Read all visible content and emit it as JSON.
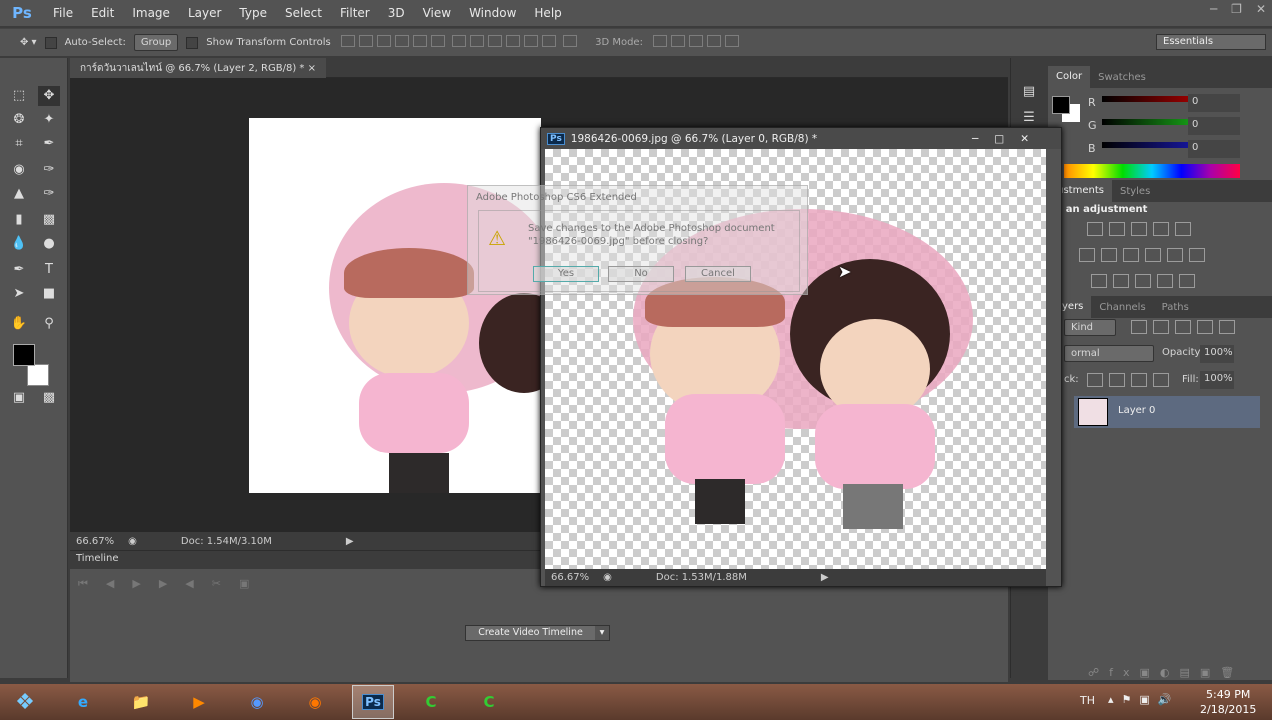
{
  "app": {
    "logo": "Ps",
    "menu": [
      "File",
      "Edit",
      "Image",
      "Layer",
      "Type",
      "Select",
      "Filter",
      "3D",
      "View",
      "Window",
      "Help"
    ]
  },
  "options": {
    "auto_select": "Auto-Select:",
    "group": "Group",
    "show_transform": "Show Transform Controls",
    "mode_3d": "3D Mode:",
    "workspace": "Essentials"
  },
  "doc1": {
    "tab": "การ์ดวันวาเลนไทน์ @ 66.7% (Layer 2, RGB/8) *",
    "zoom": "66.67%",
    "doc": "Doc: 1.54M/3.10M"
  },
  "timeline": {
    "title": "Timeline",
    "create": "Create Video Timeline"
  },
  "doc2": {
    "title": "1986426-0069.jpg @ 66.7% (Layer 0, RGB/8) *",
    "zoom": "66.67%",
    "doc": "Doc: 1.53M/1.88M"
  },
  "dialog": {
    "title": "Adobe Photoshop CS6 Extended",
    "message1": "Save changes to the Adobe Photoshop document",
    "message2": "\"1986426-0069.jpg\" before closing?",
    "yes": "Yes",
    "no": "No",
    "cancel": "Cancel"
  },
  "color_panel": {
    "tabs": [
      "Color",
      "Swatches"
    ],
    "r_label": "R",
    "g_label": "G",
    "b_label": "B",
    "r": "0",
    "g": "0",
    "b": "0",
    "fg": "#000000",
    "bg": "#ffffff"
  },
  "adjustments": {
    "tabs": [
      "djustments",
      "Styles"
    ],
    "hint": "dd an adjustment"
  },
  "layers": {
    "tabs": [
      "yers",
      "Channels",
      "Paths"
    ],
    "kind": "Kind",
    "blend": "ormal",
    "opacity_label": "Opacity:",
    "opacity": "100%",
    "lock_label": "ck:",
    "fill_label": "Fill:",
    "fill": "100%",
    "layer_name": "Layer 0"
  },
  "taskbar": {
    "lang": "TH",
    "time": "5:49 PM",
    "date": "2/18/2015",
    "apps": [
      "ie",
      "explorer",
      "media-player",
      "hp",
      "firefox",
      "photoshop",
      "camtasia",
      "camtasia-recorder"
    ]
  }
}
